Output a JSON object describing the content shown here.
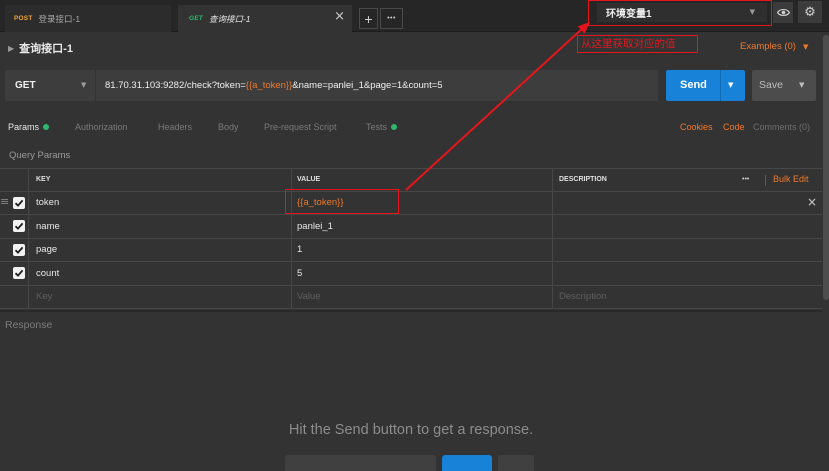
{
  "colors": {
    "background": "#333333",
    "accent_orange": "#f0792a",
    "send_blue": "#1782d8",
    "indicator_green": "#2fb86b",
    "annotation_red": "#e5161b"
  },
  "icons": {
    "env_caret": "caret-down-icon",
    "eye": "eye-icon",
    "settings": "gear-icon",
    "collapse": "caret-right-icon",
    "close": "close-icon",
    "drag": "drag-handle-icon",
    "checkbox": "checkbox-checked-icon"
  },
  "tabs": [
    {
      "method": "POST",
      "name": "登录接口-1",
      "active": false
    },
    {
      "method": "GET",
      "name": "查询接口-1",
      "active": true
    }
  ],
  "tab_actions": {
    "add": "+",
    "more": "•••"
  },
  "environment": {
    "selected": "环境变量1"
  },
  "header": {
    "request_name": "查询接口-1",
    "examples": "Examples (0)"
  },
  "annotation": {
    "text": "从这里获取对应的值"
  },
  "request": {
    "method": "GET",
    "url": {
      "prefix": "81.70.31.103:9282/check?token=",
      "variable": "{{a_token}}",
      "suffix": "&name=panlei_1&page=1&count=5"
    },
    "send_label": "Send",
    "save_label": "Save"
  },
  "request_tabs": [
    {
      "label": "Params",
      "indicator": true,
      "active": true
    },
    {
      "label": "Authorization"
    },
    {
      "label": "Headers"
    },
    {
      "label": "Body"
    },
    {
      "label": "Pre-request Script"
    },
    {
      "label": "Tests",
      "indicator": true
    }
  ],
  "request_links": {
    "cookies": "Cookies",
    "code": "Code",
    "comments": "Comments (0)"
  },
  "params": {
    "title": "Query Params",
    "columns": {
      "key": "KEY",
      "value": "VALUE",
      "description": "DESCRIPTION"
    },
    "more": "•••",
    "bulk_edit": "Bulk Edit",
    "rows": [
      {
        "key": "token",
        "value": "{{a_token}}",
        "checked": true
      },
      {
        "key": "name",
        "value": "panlei_1",
        "checked": true
      },
      {
        "key": "page",
        "value": "1",
        "checked": true
      },
      {
        "key": "count",
        "value": "5",
        "checked": true
      }
    ],
    "placeholders": {
      "key": "Key",
      "value": "Value",
      "description": "Description"
    }
  },
  "response": {
    "title": "Response",
    "hint": "Hit the Send button to get a response."
  }
}
